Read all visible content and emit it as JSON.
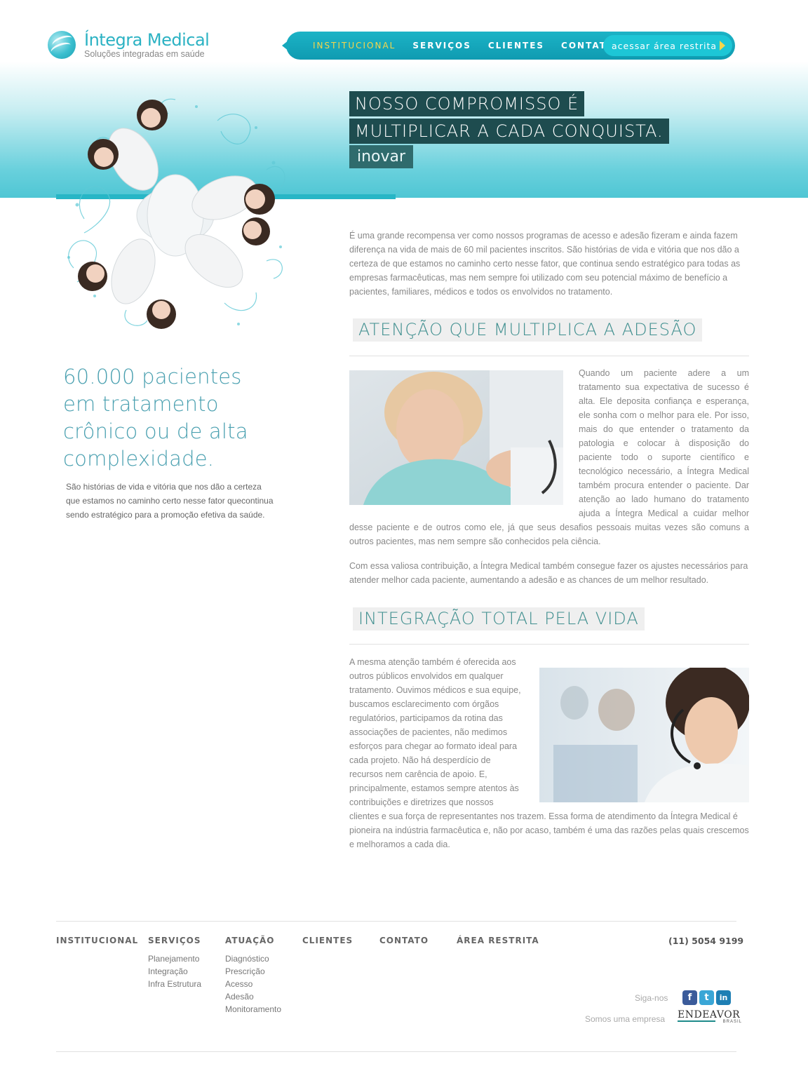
{
  "brand": {
    "name": "Íntegra Medical",
    "tagline": "Soluções integradas em saúde",
    "accent": "#27b6c6",
    "nav_active_color": "#f6d64a",
    "title_dark": "#1e4c4f"
  },
  "nav": {
    "items": [
      {
        "label": "INSTITUCIONAL",
        "active": true
      },
      {
        "label": "SERVIÇOS",
        "active": false
      },
      {
        "label": "CLIENTES",
        "active": false
      },
      {
        "label": "CONTATO",
        "active": false
      }
    ],
    "cta_label": "acessar área restrita"
  },
  "hero": {
    "line1": "NOSSO COMPROMISSO É",
    "line2": "MULTIPLICAR A CADA CONQUISTA.",
    "sub": "inovar"
  },
  "stat": {
    "headline": "60.000 pacientes em tratamento crônico ou de alta complexidade.",
    "text": "São histórias de vida e vitória que nos dão a certeza que estamos no caminho certo nesse fator quecontinua sendo estratégico para a promoção efetiva da saúde."
  },
  "intro": "É uma grande recompensa ver como nossos programas de acesso e adesão fizeram e ainda fazem diferença na vida de mais de 60 mil pacientes inscritos. São histórias de vida e vitória que nos dão a certeza de que estamos no caminho certo nesse fator, que continua sendo estratégico para todas as empresas farmacêuticas, mas nem sempre foi utilizado com seu potencial máximo de benefício a pacientes, familiares, médicos e todos os envolvidos no tratamento.",
  "section1": {
    "title": "ATENÇÃO QUE MULTIPLICA A ADESÃO",
    "p1": "Quando um paciente adere a um tratamento sua expectativa de sucesso é alta. Ele deposita confiança e esperança, ele sonha com o melhor para ele. Por isso, mais do que entender o tratamento da patologia e colocar à disposição do paciente todo o suporte científico e tecnológico necessário, a Íntegra Medical também procura entender o paciente. Dar atenção ao lado humano do tratamento ajuda a Íntegra Medical a cuidar melhor desse paciente e de outros como ele, já que seus desafios pessoais muitas vezes são comuns a outros pacientes, mas nem sempre são conhecidos pela ciência.",
    "p2": "Com essa valiosa contribuição, a Íntegra Medical também consegue fazer os ajustes necessários para atender melhor cada paciente, aumentando a adesão e as chances de um melhor resultado."
  },
  "section2": {
    "title": "INTEGRAÇÃO TOTAL PELA VIDA",
    "p1": "A mesma atenção também é oferecida aos outros públicos envolvidos em qualquer tratamento. Ouvimos médicos e sua equipe, buscamos esclarecimento com órgãos regulatórios, participamos da rotina das associações de pacientes, não medimos esforços para chegar ao formato ideal para cada projeto. Não há desperdício de recursos nem carência de apoio. E, principalmente, estamos sempre atentos às contribuições e diretrizes que nossos clientes e sua força de representantes nos trazem. Essa forma de atendimento da Íntegra Medical é pioneira na indústria farmacêutica e, não por acaso, também é uma das razões pelas quais crescemos e melhoramos a cada dia."
  },
  "footer": {
    "cols": [
      {
        "title": "INSTITUCIONAL",
        "links": []
      },
      {
        "title": "SERVIÇOS",
        "links": [
          "Planejamento",
          "Integração",
          "Infra Estrutura"
        ]
      },
      {
        "title": "ATUAÇÃO",
        "links": [
          "Diagnóstico",
          "Prescrição",
          "Acesso",
          "Adesão",
          "Monitoramento"
        ]
      },
      {
        "title": "CLIENTES",
        "links": []
      },
      {
        "title": "CONTATO",
        "links": []
      },
      {
        "title": "ÁREA RESTRITA",
        "links": []
      }
    ],
    "phone": "(11) 5054 9199",
    "follow_label": "Siga-nos",
    "social": [
      {
        "icon": "facebook-icon",
        "glyph": "f"
      },
      {
        "icon": "twitter-icon",
        "glyph": "t"
      },
      {
        "icon": "linkedin-icon",
        "glyph": "in"
      }
    ],
    "company_label": "Somos uma empresa",
    "partner": {
      "word": "ENDEAVOR",
      "sub": "BRASIL"
    }
  }
}
